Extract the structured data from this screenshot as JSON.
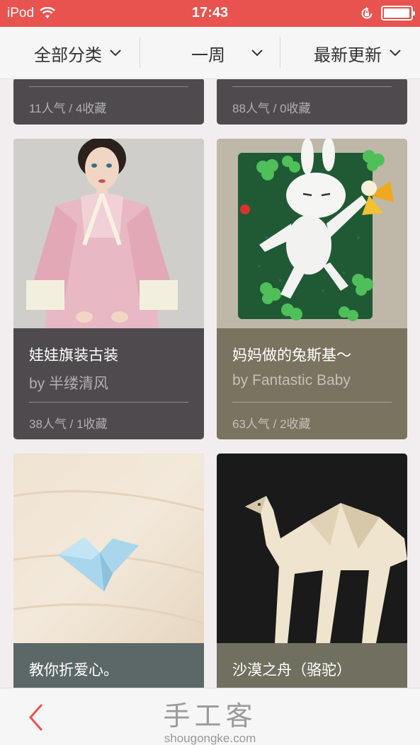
{
  "status": {
    "carrier": "iPod",
    "time": "17:43"
  },
  "filters": {
    "category": "全部分类",
    "period": "一周",
    "sort": "最新更新"
  },
  "cards": [
    {
      "title": "",
      "author": "",
      "stats": "11人气 / 4收藏"
    },
    {
      "title": "",
      "author": "",
      "stats": "88人气 / 0收藏"
    },
    {
      "title": "娃娃旗装古装",
      "author": "by 半缕清风",
      "stats": "38人气 / 1收藏"
    },
    {
      "title": "妈妈做的兔斯基～",
      "author": "by Fantastic Baby",
      "stats": "63人气 / 2收藏"
    },
    {
      "title": "教你折爱心。",
      "author": "",
      "stats": ""
    },
    {
      "title": "沙漠之舟（骆驼）",
      "author": "",
      "stats": ""
    }
  ],
  "footer": {
    "logo_cn": "手工客",
    "logo_en": "shougongke.com"
  },
  "colors": {
    "status_bar": "#e8534f",
    "back_accent": "#e8534f"
  }
}
